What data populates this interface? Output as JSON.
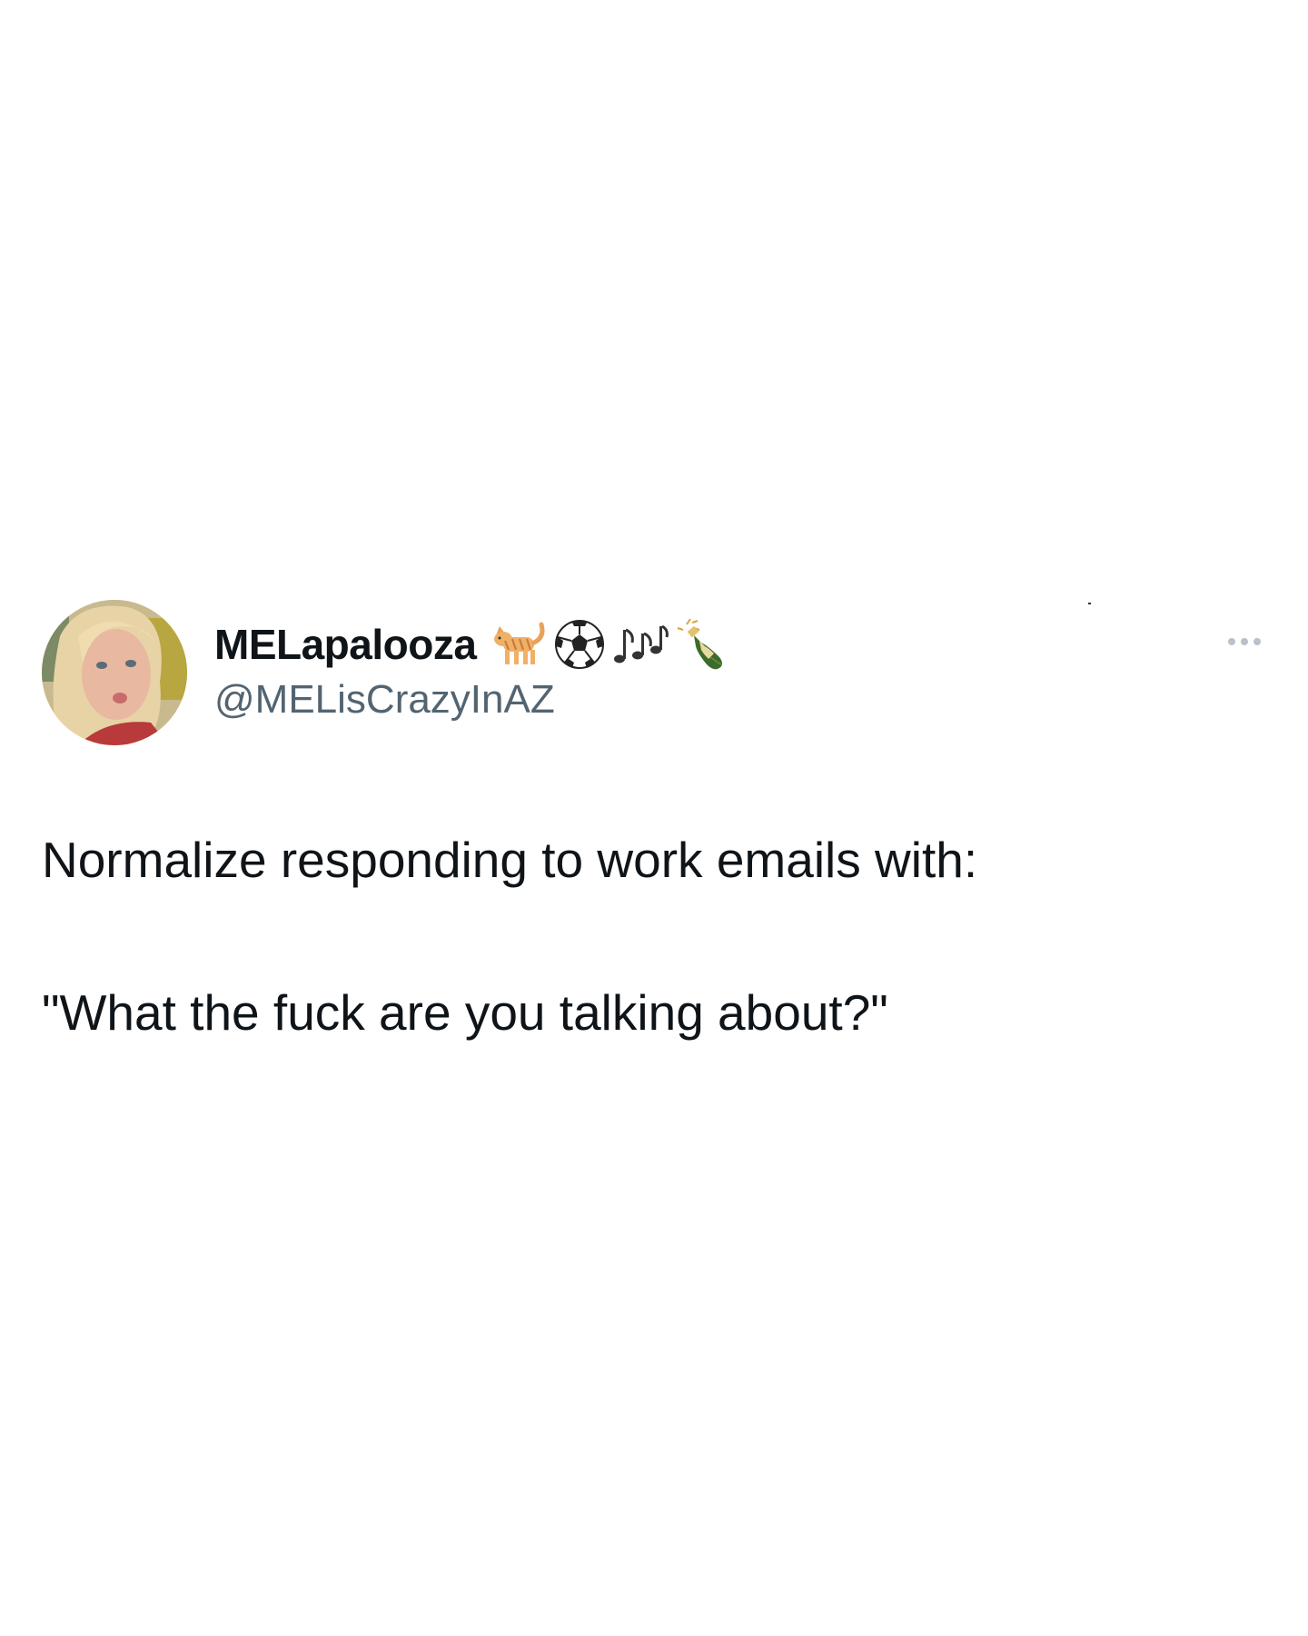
{
  "author": {
    "display_name": "MELapalooza",
    "handle": "@MELisCrazyInAZ",
    "name_emojis": [
      "cat-icon",
      "soccer-ball-icon",
      "music-notes-icon",
      "champagne-icon"
    ]
  },
  "tweet": {
    "line1": "Normalize responding to work emails with:",
    "line2": "\"What the fuck are you talking about?\""
  },
  "colors": {
    "text_primary": "#0f1419",
    "text_secondary": "#536471",
    "background": "#ffffff",
    "more_dots": "#b9c2ca"
  }
}
